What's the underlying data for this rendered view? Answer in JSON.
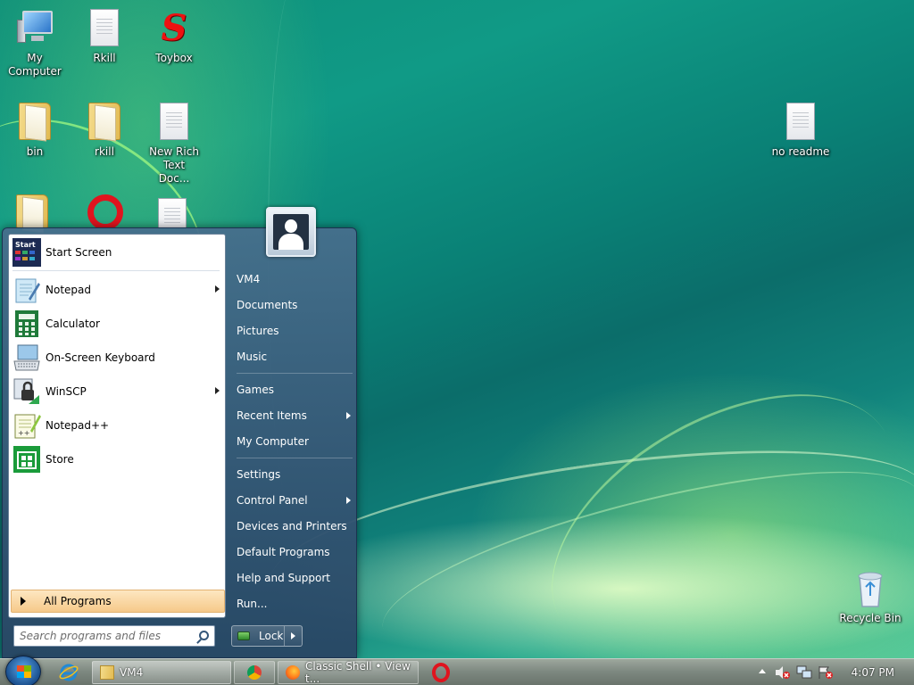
{
  "desktop": {
    "icons": [
      {
        "label": "My Computer"
      },
      {
        "label": "Rkill"
      },
      {
        "label": "Toybox"
      },
      {
        "label": "bin"
      },
      {
        "label": "rkill"
      },
      {
        "label": "New Rich Text Doc..."
      },
      {
        "label": "no readme"
      },
      {
        "label": "Recycle Bin"
      }
    ]
  },
  "start_menu": {
    "pinned": [
      {
        "label": "Start Screen",
        "icon": "start-screen-icon"
      }
    ],
    "recent": [
      {
        "label": "Notepad",
        "icon": "notepad-icon",
        "submenu": true
      },
      {
        "label": "Calculator",
        "icon": "calculator-icon",
        "submenu": false
      },
      {
        "label": "On-Screen Keyboard",
        "icon": "keyboard-icon",
        "submenu": false
      },
      {
        "label": "WinSCP",
        "icon": "winscp-icon",
        "submenu": true
      },
      {
        "label": "Notepad++",
        "icon": "notepadpp-icon",
        "submenu": false
      },
      {
        "label": "Store",
        "icon": "store-icon",
        "submenu": false
      }
    ],
    "all_programs": "All Programs",
    "search_placeholder": "Search programs and files",
    "right": [
      {
        "label": "VM4"
      },
      {
        "label": "Documents"
      },
      {
        "label": "Pictures"
      },
      {
        "label": "Music"
      },
      {
        "label": "Games"
      },
      {
        "label": "Recent Items",
        "submenu": true
      },
      {
        "label": "My Computer"
      },
      {
        "label": "Settings"
      },
      {
        "label": "Control Panel",
        "submenu": true
      },
      {
        "label": "Devices and Printers"
      },
      {
        "label": "Default Programs"
      },
      {
        "label": "Help and Support"
      },
      {
        "label": "Run..."
      }
    ],
    "lock_label": "Lock"
  },
  "taskbar": {
    "buttons": [
      {
        "label": "VM4",
        "icon": "folder-icon"
      },
      {
        "label": "",
        "icon": "chrome-icon"
      },
      {
        "label": "Classic Shell • View t...",
        "icon": "firefox-icon"
      }
    ],
    "clock": "4:07 PM"
  },
  "colors": {
    "accent": "#f6c98a",
    "menu_right": "#3e6283",
    "taskbar": "#7c877f"
  }
}
